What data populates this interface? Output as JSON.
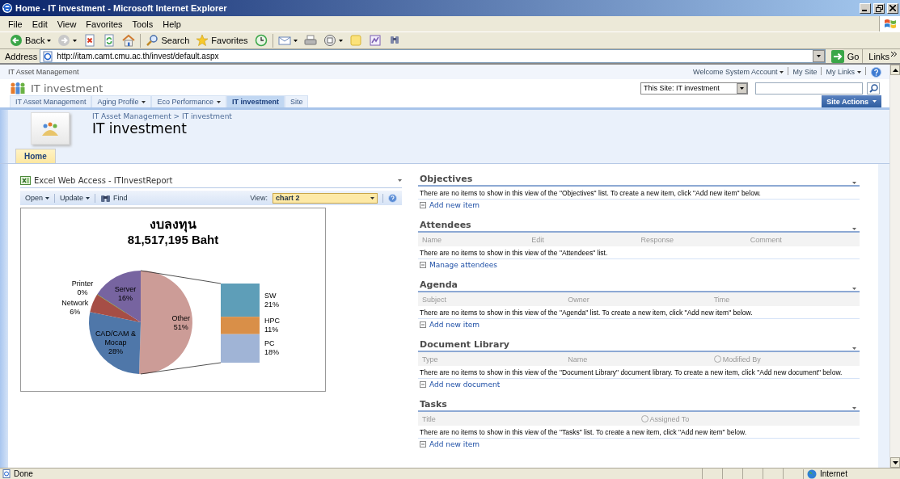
{
  "window": {
    "title": "Home - IT investment - Microsoft Internet Explorer"
  },
  "menu": [
    "File",
    "Edit",
    "View",
    "Favorites",
    "Tools",
    "Help"
  ],
  "toolbar": [
    {
      "kind": "back",
      "label": "Back",
      "menu": true
    },
    {
      "kind": "forward",
      "menu": true
    },
    {
      "kind": "stop"
    },
    {
      "kind": "refresh"
    },
    {
      "kind": "home"
    },
    {
      "kind": "search",
      "label": "Search"
    },
    {
      "kind": "favorites",
      "label": "Favorites"
    },
    {
      "kind": "history"
    },
    {
      "kind": "mail",
      "menu": true
    },
    {
      "kind": "print"
    },
    {
      "kind": "edit",
      "menu": true
    },
    {
      "kind": "note"
    },
    {
      "kind": "discuss"
    },
    {
      "kind": "research"
    }
  ],
  "address": {
    "label": "Address",
    "value": "http://itam.camt.cmu.ac.th/invest/default.aspx",
    "go": "Go",
    "links": "Links"
  },
  "site": {
    "top_label": "IT Asset Management",
    "user_links": [
      {
        "label": "Welcome System Account",
        "dropdown": true
      },
      {
        "label": "My Site",
        "dropdown": false
      },
      {
        "label": "My Links",
        "dropdown": true
      }
    ],
    "title": "IT investment",
    "search_scope": "This Site: IT investment",
    "nav_tabs": [
      {
        "label": "IT Asset Management",
        "selected": false,
        "dropdown": false
      },
      {
        "label": "Aging Profile",
        "selected": false,
        "dropdown": true
      },
      {
        "label": "Eco Performance",
        "selected": false,
        "dropdown": true
      },
      {
        "label": "IT investment",
        "selected": true,
        "dropdown": false
      },
      {
        "label": "Site",
        "selected": false,
        "dropdown": false
      }
    ],
    "site_actions": "Site Actions",
    "breadcrumb": "IT Asset Management > IT investment",
    "page_title": "IT investment",
    "page_tabs": [
      {
        "label": "Home",
        "selected": true
      }
    ]
  },
  "webpart": {
    "title": "Excel Web Access - ITInvestReport",
    "toolbar": [
      {
        "kind": "menu",
        "label": "Open"
      },
      {
        "kind": "menu",
        "label": "Update"
      },
      {
        "kind": "find",
        "label": "Find"
      }
    ],
    "view_label": "View:",
    "view_value": "chart 2",
    "chart_data": {
      "type": "pie",
      "title": "งบลงทุน",
      "subtitle": "81,517,195 Baht",
      "categories": [
        "Other",
        "CAD/CAM & Mocap",
        "Network",
        "Printer",
        "Server"
      ],
      "colors": [
        "#cc9c97",
        "#4f77a9",
        "#a64e46",
        "#9bbb59",
        "#7764a0"
      ],
      "values": [
        51,
        28,
        6,
        0,
        16
      ],
      "value_labels": [
        "51%",
        "28%",
        "6%",
        "0%",
        "16%"
      ]
    },
    "breakdown": [
      {
        "label": "SW",
        "share": "21%",
        "color": "#5e9eb8"
      },
      {
        "label": "HPC",
        "share": "11%",
        "color": "#d98f48"
      },
      {
        "label": "PC",
        "share": "18%",
        "color": "#a0b4d6"
      }
    ]
  },
  "lists": [
    {
      "title": "Objectives",
      "message": "There are no items to show in this view of the \"Objectives\" list. To create a new item, click \"Add new item\" below.",
      "link": "Add new item"
    },
    {
      "title": "Attendees",
      "columns": [
        {
          "label": "Name",
          "presence": false
        },
        {
          "label": "Edit",
          "presence": false
        },
        {
          "label": "Response",
          "presence": false
        },
        {
          "label": "Comment",
          "presence": false
        }
      ],
      "message": "There are no items to show in this view of the \"Attendees\" list.",
      "link": "Manage attendees"
    },
    {
      "title": "Agenda",
      "columns": [
        {
          "label": "Subject",
          "presence": false
        },
        {
          "label": "Owner",
          "presence": false
        },
        {
          "label": "Time",
          "presence": false
        }
      ],
      "message": "There are no items to show in this view of the \"Agenda\" list. To create a new item, click \"Add new item\" below.",
      "link": "Add new item"
    },
    {
      "title": "Document Library",
      "columns": [
        {
          "label": "Type",
          "presence": false
        },
        {
          "label": "Name",
          "presence": false
        },
        {
          "label": "Modified By",
          "presence": true
        }
      ],
      "message": "There are no items to show in this view of the \"Document Library\" document library. To create a new item, click \"Add new document\" below.",
      "link": "Add new document"
    },
    {
      "title": "Tasks",
      "columns": [
        {
          "label": "Title",
          "presence": false
        },
        {
          "label": "Assigned To",
          "presence": true
        }
      ],
      "message": "There are no items to show in this view of the \"Tasks\" list. To create a new item, click \"Add new item\" below.",
      "link": "Add new item"
    }
  ],
  "status_bar": {
    "text": "Done",
    "zone": "Internet"
  }
}
